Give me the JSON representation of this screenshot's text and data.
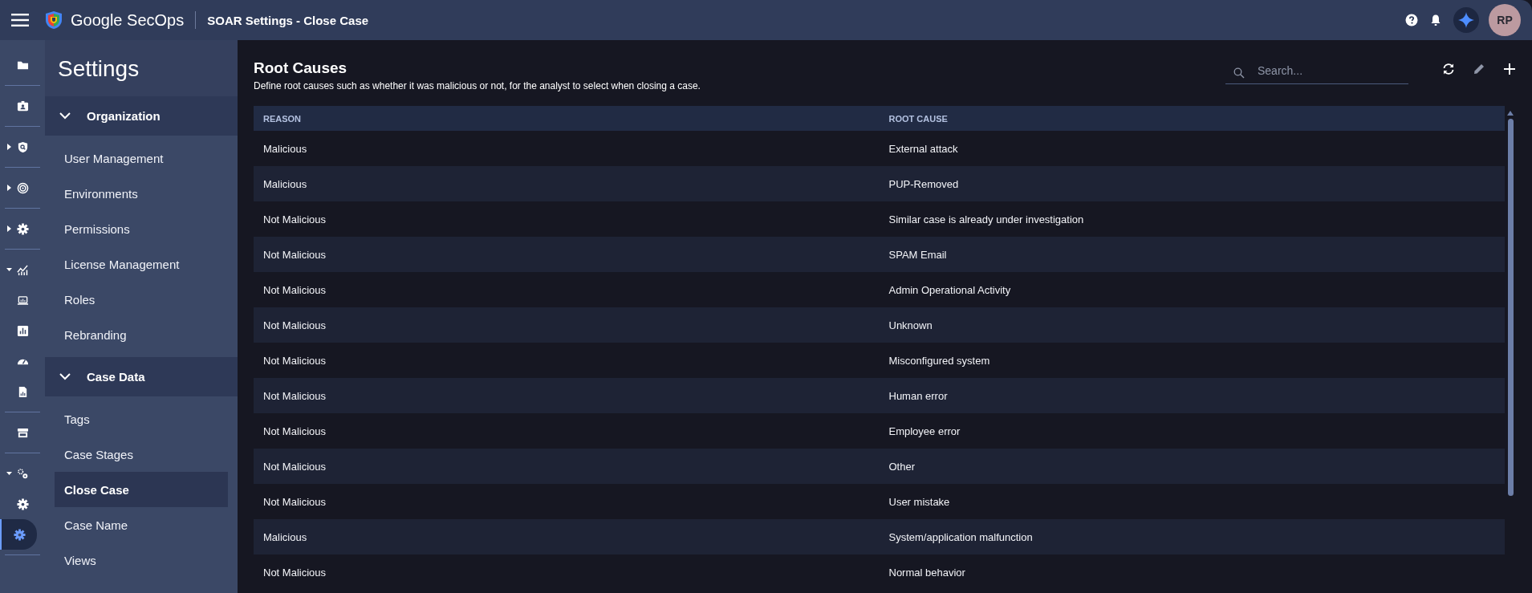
{
  "header": {
    "brand": "Google SecOps",
    "title": "SOAR Settings - Close Case",
    "avatar": "RP"
  },
  "rail": [
    [
      {
        "kind": "plain",
        "selected": false
      }
    ],
    [
      {
        "kind": "plain",
        "selected": false
      }
    ],
    [
      {
        "kind": "collapsed",
        "selected": false
      }
    ],
    [
      {
        "kind": "collapsed",
        "selected": false
      }
    ],
    [
      {
        "kind": "collapsed",
        "selected": false
      }
    ],
    [
      {
        "kind": "expanded",
        "selected": false
      },
      {
        "kind": "plain",
        "selected": false
      },
      {
        "kind": "plain",
        "selected": false
      },
      {
        "kind": "plain",
        "selected": false
      },
      {
        "kind": "plain",
        "selected": false
      }
    ],
    [
      {
        "kind": "plain",
        "selected": false
      }
    ],
    [
      {
        "kind": "expanded",
        "selected": false
      },
      {
        "kind": "plain",
        "selected": false
      },
      {
        "kind": "plain",
        "selected": true
      }
    ]
  ],
  "sidebar": {
    "title": "Settings",
    "sections": [
      {
        "label": "Organization",
        "expanded": true,
        "items": [
          {
            "label": "User Management",
            "selected": false
          },
          {
            "label": "Environments",
            "selected": false
          },
          {
            "label": "Permissions",
            "selected": false
          },
          {
            "label": "License Management",
            "selected": false
          },
          {
            "label": "Roles",
            "selected": false
          },
          {
            "label": "Rebranding",
            "selected": false
          }
        ]
      },
      {
        "label": "Case Data",
        "expanded": true,
        "items": [
          {
            "label": "Tags",
            "selected": false
          },
          {
            "label": "Case Stages",
            "selected": false
          },
          {
            "label": "Close Case",
            "selected": true
          },
          {
            "label": "Case Name",
            "selected": false
          },
          {
            "label": "Views",
            "selected": false
          }
        ]
      }
    ]
  },
  "main": {
    "title": "Root Causes",
    "description": "Define root causes such as whether it was malicious or not, for the analyst to select when closing a case.",
    "search": {
      "placeholder": "Search..."
    }
  },
  "table": {
    "columns": [
      "REASON",
      "ROOT CAUSE"
    ],
    "rows": [
      [
        "Malicious",
        "External attack"
      ],
      [
        "Malicious",
        "PUP-Removed"
      ],
      [
        "Not Malicious",
        "Similar case is already under investigation"
      ],
      [
        "Not Malicious",
        "SPAM Email"
      ],
      [
        "Not Malicious",
        "Admin Operational Activity"
      ],
      [
        "Not Malicious",
        "Unknown"
      ],
      [
        "Not Malicious",
        "Misconfigured system"
      ],
      [
        "Not Malicious",
        "Human error"
      ],
      [
        "Not Malicious",
        "Employee error"
      ],
      [
        "Not Malicious",
        "Other"
      ],
      [
        "Not Malicious",
        "User mistake"
      ],
      [
        "Malicious",
        "System/application malfunction"
      ],
      [
        "Not Malicious",
        "Normal behavior"
      ]
    ]
  }
}
